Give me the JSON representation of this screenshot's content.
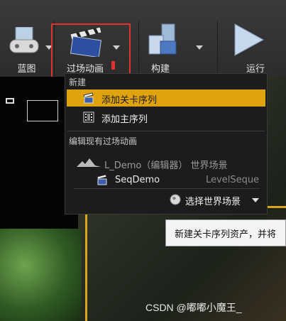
{
  "toolbar": {
    "blueprint_label": "蓝图",
    "cinematics_label": "过场动画",
    "build_label": "构建",
    "run_label": "运行"
  },
  "menu": {
    "new_section": "新建",
    "items": [
      {
        "label": "添加关卡序列",
        "icon": "level-sequence-icon",
        "selected": true
      },
      {
        "label": "添加主序列",
        "icon": "film-strip-icon",
        "selected": false
      }
    ],
    "edit_section": "编辑现有过场动画",
    "tree": {
      "world": "L_Demo（编辑器） 世界场景",
      "sequence_name": "SeqDemo",
      "sequence_type": "LevelSeque"
    },
    "select_world_label": "选择世界场景"
  },
  "tooltip": {
    "text": "新建关卡序列资产，并将"
  },
  "watermark": "CSDN @嘟嘟小魔王_",
  "colors": {
    "selected": "#e0a310",
    "highlight_box": "#e23131"
  }
}
